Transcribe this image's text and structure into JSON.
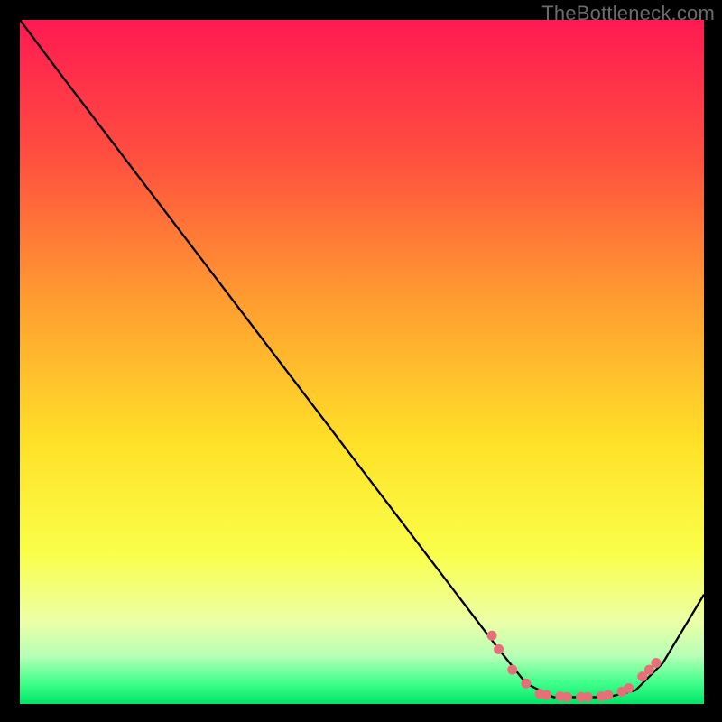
{
  "watermark": "TheBottleneck.com",
  "chart_data": {
    "type": "line",
    "title": "",
    "xlabel": "",
    "ylabel": "",
    "xlim": [
      0,
      100
    ],
    "ylim": [
      0,
      100
    ],
    "grid": false,
    "series": [
      {
        "name": "curve",
        "x": [
          0,
          6,
          70,
          74,
          78,
          82,
          86,
          90,
          94,
          100
        ],
        "y": [
          100,
          92,
          8,
          3,
          1,
          1,
          1,
          2,
          6,
          16
        ]
      }
    ],
    "markers": {
      "name": "dots",
      "x": [
        69,
        70,
        72,
        74,
        76,
        77,
        79,
        80,
        82,
        83,
        85,
        86,
        88,
        89,
        91,
        92,
        93
      ],
      "y": [
        10,
        8,
        5,
        3,
        1.5,
        1.3,
        1.1,
        1.0,
        1.0,
        1.0,
        1.1,
        1.3,
        1.8,
        2.3,
        4.0,
        5.0,
        6.0
      ]
    },
    "background_gradient": [
      {
        "stop": 0.0,
        "color": "#ff1a52"
      },
      {
        "stop": 0.2,
        "color": "#ff4f3f"
      },
      {
        "stop": 0.42,
        "color": "#ffa030"
      },
      {
        "stop": 0.62,
        "color": "#ffe128"
      },
      {
        "stop": 0.78,
        "color": "#faff4a"
      },
      {
        "stop": 0.88,
        "color": "#ecffa8"
      },
      {
        "stop": 0.93,
        "color": "#b6ffb6"
      },
      {
        "stop": 0.97,
        "color": "#3fff8a"
      },
      {
        "stop": 1.0,
        "color": "#00e566"
      }
    ],
    "marker_color": "#e76f78",
    "line_color": "#000000"
  }
}
